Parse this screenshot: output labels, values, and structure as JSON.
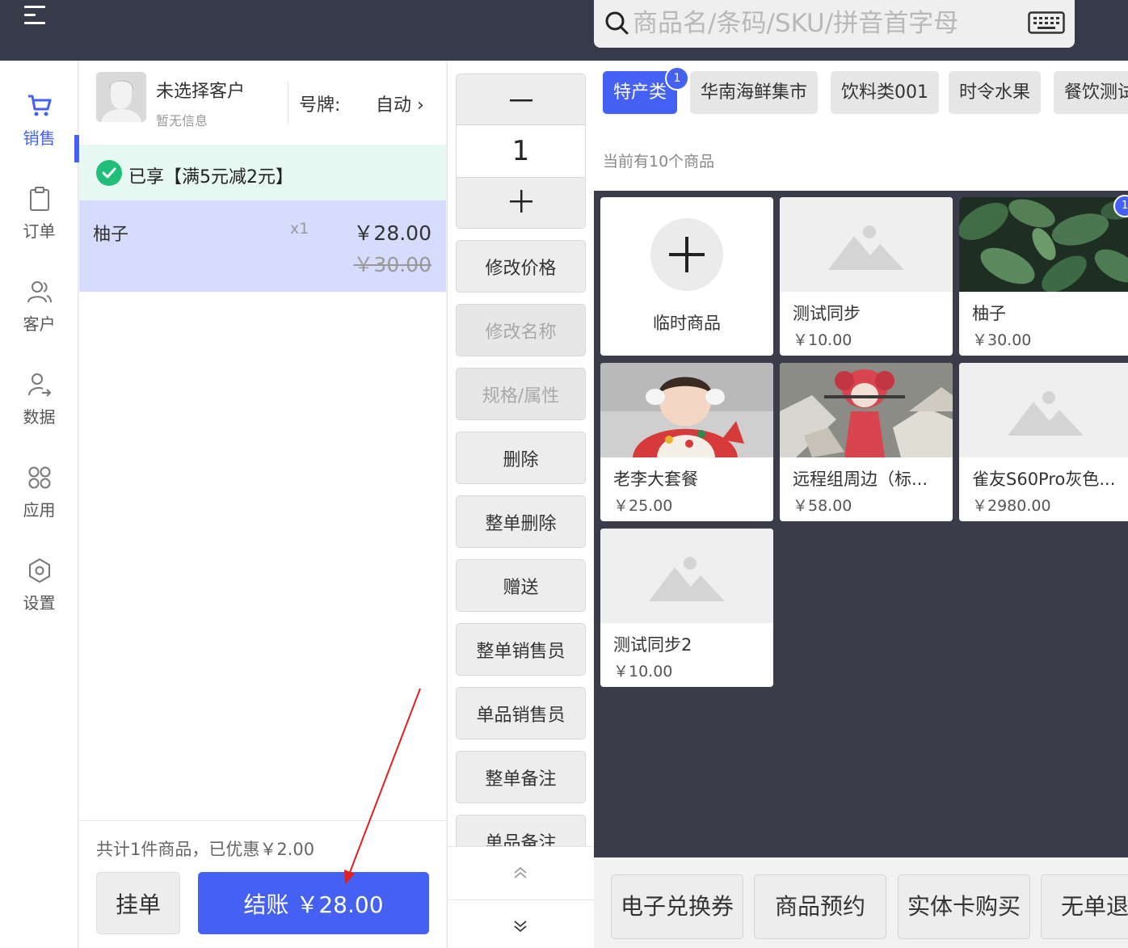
{
  "header": {
    "search_placeholder": "商品名/条码/SKU/拼音首字母",
    "menu_icon": "menu-icon",
    "keyboard_icon": "keyboard-icon"
  },
  "sidebar": {
    "items": [
      {
        "label": "销售",
        "icon": "cart-icon",
        "active": true
      },
      {
        "label": "订单",
        "icon": "clipboard-icon"
      },
      {
        "label": "客户",
        "icon": "users-icon"
      },
      {
        "label": "数据",
        "icon": "user-share-icon"
      },
      {
        "label": "应用",
        "icon": "apps-icon"
      },
      {
        "label": "设置",
        "icon": "gear-icon"
      }
    ]
  },
  "customer": {
    "name": "未选择客户",
    "info": "暂无信息",
    "plate_label": "号牌:",
    "plate_value": "自动 ›"
  },
  "promo": {
    "text": "已享【满5元减2元】"
  },
  "cart": {
    "items": [
      {
        "name": "柚子",
        "qty": "x1",
        "price": "￥28.00",
        "original_price": "￥30.00"
      }
    ],
    "summary": "共计1件商品，已优惠￥2.00",
    "hold_label": "挂单",
    "checkout_label": "结账 ￥28.00"
  },
  "actions": {
    "minus": "−",
    "quantity": "1",
    "plus": "+",
    "buttons": [
      {
        "label": "修改价格"
      },
      {
        "label": "修改名称",
        "disabled": true
      },
      {
        "label": "规格/属性",
        "disabled": true
      },
      {
        "label": "删除"
      },
      {
        "label": "整单删除"
      },
      {
        "label": "赠送"
      },
      {
        "label": "整单销售员"
      },
      {
        "label": "单品销售员"
      },
      {
        "label": "整单备注"
      },
      {
        "label": "单品备注"
      }
    ]
  },
  "categories": {
    "tabs": [
      {
        "label": "特产类",
        "active": true,
        "badge": "1"
      },
      {
        "label": "华南海鲜集市"
      },
      {
        "label": "饮料类001"
      },
      {
        "label": "时令水果"
      },
      {
        "label": "餐饮测试"
      }
    ],
    "count_text": "当前有10个商品"
  },
  "products": [
    {
      "name": "临时商品",
      "type": "temporary",
      "icon": "plus-icon"
    },
    {
      "name": "测试同步",
      "price": "￥10.00",
      "image": "placeholder-image-icon"
    },
    {
      "name": "柚子",
      "price": "￥30.00",
      "image": "leaves-photo",
      "badge": "1"
    },
    {
      "name": "老李大套餐",
      "price": "￥25.00",
      "image": "child-photo"
    },
    {
      "name": "远程组周边（标...",
      "price": "￥58.00",
      "image": "figurine-photo"
    },
    {
      "name": "雀友S60Pro灰色...",
      "price": "￥2980.00",
      "image": "placeholder-image-icon"
    },
    {
      "name": "测试同步2",
      "price": "￥10.00",
      "image": "placeholder-image-icon"
    }
  ],
  "bottom_actions": [
    {
      "label": "电子兑换券"
    },
    {
      "label": "商品预约"
    },
    {
      "label": "实体卡购买"
    },
    {
      "label": "无单退货"
    }
  ],
  "colors": {
    "accent": "#4561f3",
    "topbar": "#373a48",
    "selected_row": "#d6dcfb",
    "promo_bg": "#e6f8f1",
    "promo_check": "#1fbf7a",
    "annotation_arrow": "#e02020"
  }
}
